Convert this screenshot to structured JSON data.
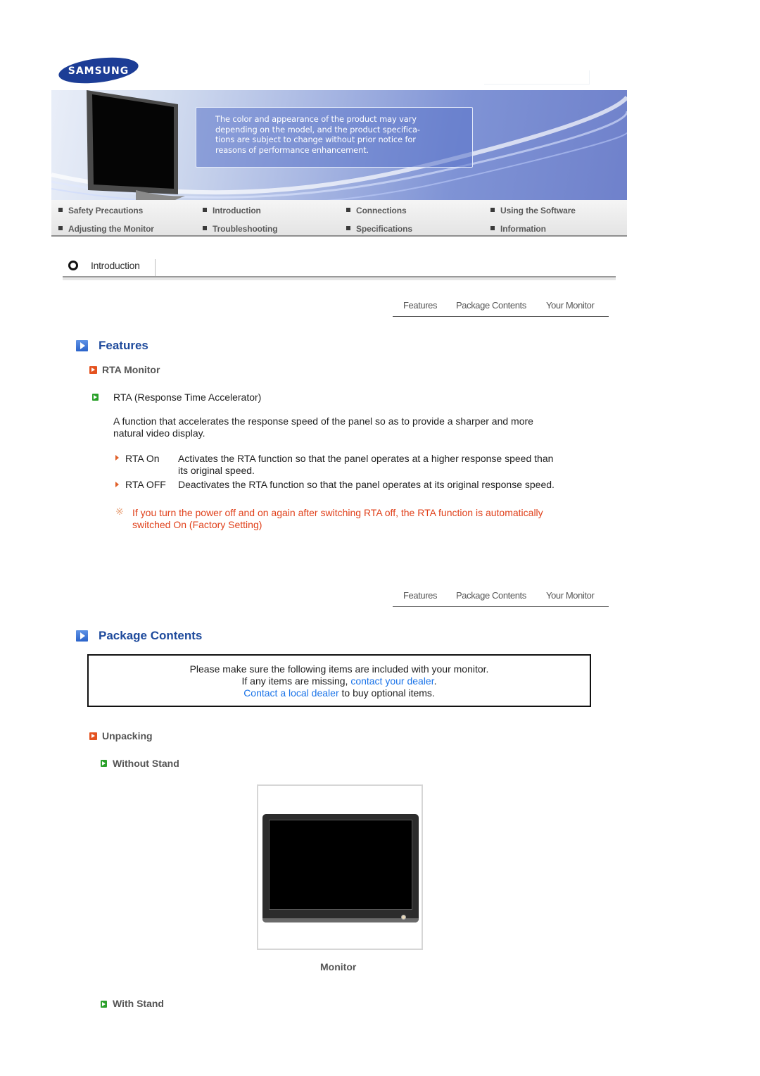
{
  "header": {
    "brand": "SAMSUNG",
    "banner_notice": "The color and appearance of the product may vary depending on the model, and the product specifications are subject to change without prior notice for reasons of performance enhancement.",
    "banner_lines": [
      "The color and appearance of the product may vary",
      "depending on the model, and the product specifica-",
      "tions are subject to change without prior notice for",
      "reasons of performance enhancement."
    ]
  },
  "main_nav": {
    "items": [
      {
        "label": "Safety Precautions"
      },
      {
        "label": "Introduction"
      },
      {
        "label": "Connections"
      },
      {
        "label": "Using the Software"
      },
      {
        "label": "Adjusting the Monitor"
      },
      {
        "label": "Troubleshooting"
      },
      {
        "label": "Specifications"
      },
      {
        "label": "Information"
      }
    ]
  },
  "breadcrumb": {
    "current": "Introduction"
  },
  "sub_nav": {
    "items": [
      {
        "label": "Features"
      },
      {
        "label": "Package Contents"
      },
      {
        "label": "Your Monitor"
      }
    ]
  },
  "features": {
    "title": "Features",
    "subsection": "RTA Monitor",
    "item_title": "RTA (Response Time Accelerator)",
    "description": "A function that accelerates the response speed of the panel so as to provide a sharper and more natural video display.",
    "description_lines": [
      "A function that accelerates the response speed of the panel so as to provide a sharper and more",
      "natural video display."
    ],
    "options": [
      {
        "name": "RTA On",
        "desc_lines": [
          "Activates the RTA function so that the panel operates at a higher response speed than",
          "its original speed."
        ]
      },
      {
        "name": "RTA OFF",
        "desc_lines": [
          "Deactivates the RTA function so that the panel operates at its original response speed."
        ]
      }
    ],
    "note_lines": [
      "If you turn the power off and on again after switching RTA off, the RTA function is automatically",
      "switched On (Factory Setting)"
    ],
    "note_mark": "※"
  },
  "package": {
    "title": "Package Contents",
    "box": {
      "line1": "Please make sure the following items are included with your monitor.",
      "line2_prefix": "If any items are missing, ",
      "line2_link": "contact your dealer",
      "line2_suffix": ".",
      "line3_link": "Contact a local dealer",
      "line3_suffix": " to buy optional items."
    },
    "subsection": "Unpacking",
    "without_stand": "Without Stand",
    "image_caption": "Monitor",
    "with_stand": "With Stand"
  },
  "colors": {
    "section_title": "#1e4a9c",
    "note": "#e0401a",
    "link": "#1a73e8",
    "subsection_icon": "#e4521f",
    "item_icon": "#2aa02a"
  }
}
